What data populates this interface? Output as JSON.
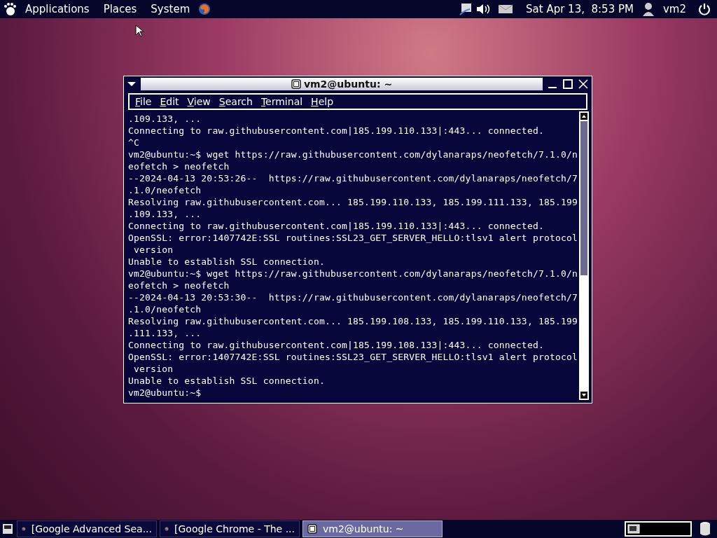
{
  "top_panel": {
    "menus": [
      "Applications",
      "Places",
      "System"
    ],
    "clock": "Sat Apr 13,  8:53 PM",
    "user": "vm2"
  },
  "terminal": {
    "title": "vm2@ubuntu: ~",
    "menu": [
      "File",
      "Edit",
      "View",
      "Search",
      "Terminal",
      "Help"
    ],
    "lines": [
      ".109.133, ...",
      "Connecting to raw.githubusercontent.com|185.199.110.133|:443... connected.",
      "^C",
      "vm2@ubuntu:~$ wget https://raw.githubusercontent.com/dylanaraps/neofetch/7.1.0/n",
      "eofetch > neofetch",
      "--2024-04-13 20:53:26--  https://raw.githubusercontent.com/dylanaraps/neofetch/7",
      ".1.0/neofetch",
      "Resolving raw.githubusercontent.com... 185.199.110.133, 185.199.111.133, 185.199",
      ".109.133, ...",
      "Connecting to raw.githubusercontent.com|185.199.110.133|:443... connected.",
      "OpenSSL: error:1407742E:SSL routines:SSL23_GET_SERVER_HELLO:tlsv1 alert protocol",
      " version",
      "Unable to establish SSL connection.",
      "vm2@ubuntu:~$ wget https://raw.githubusercontent.com/dylanaraps/neofetch/7.1.0/n",
      "eofetch > neofetch",
      "--2024-04-13 20:53:30--  https://raw.githubusercontent.com/dylanaraps/neofetch/7",
      ".1.0/neofetch",
      "Resolving raw.githubusercontent.com... 185.199.108.133, 185.199.110.133, 185.199",
      ".111.133, ...",
      "Connecting to raw.githubusercontent.com|185.199.108.133|:443... connected.",
      "OpenSSL: error:1407742E:SSL routines:SSL23_GET_SERVER_HELLO:tlsv1 alert protocol",
      " version",
      "Unable to establish SSL connection.",
      "vm2@ubuntu:~$ "
    ]
  },
  "taskbar": {
    "tasks": [
      {
        "kind": "browser",
        "label": "[Google Advanced Sea...",
        "selected": false
      },
      {
        "kind": "browser",
        "label": "[Google Chrome - The ...",
        "selected": false
      },
      {
        "kind": "terminal",
        "label": "vm2@ubuntu: ~",
        "selected": true
      }
    ]
  }
}
